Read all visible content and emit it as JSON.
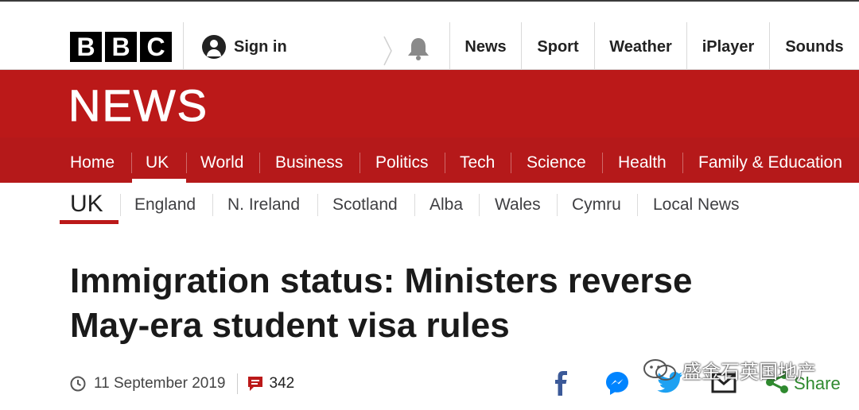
{
  "brand": {
    "letters": [
      "B",
      "B",
      "C"
    ]
  },
  "account": {
    "sign_in": "Sign in"
  },
  "top_nav": [
    "News",
    "Sport",
    "Weather",
    "iPlayer",
    "Sounds"
  ],
  "section": {
    "title": "NEWS"
  },
  "main_nav": [
    "Home",
    "UK",
    "World",
    "Business",
    "Politics",
    "Tech",
    "Science",
    "Health",
    "Family & Education"
  ],
  "main_nav_active": "UK",
  "sub_nav": {
    "current": "UK",
    "items": [
      "England",
      "N. Ireland",
      "Scotland",
      "Alba",
      "Wales",
      "Cymru",
      "Local News"
    ]
  },
  "article": {
    "headline_line1": "Immigration status: Ministers reverse",
    "headline_line2": "May-era student visa rules",
    "date": "11 September 2019",
    "comment_count": "342"
  },
  "share": {
    "label": "Share",
    "icons": [
      "facebook-icon",
      "messenger-icon",
      "twitter-icon",
      "email-icon",
      "share-icon"
    ]
  },
  "overlay": {
    "watermark_text": "盛金石英国地产"
  },
  "colors": {
    "bbc_red": "#bb1919",
    "black": "#000000",
    "text": "#222222",
    "share_green": "#2f8a2f",
    "facebook": "#3b5998",
    "messenger": "#0084ff",
    "twitter": "#1da1f2"
  }
}
